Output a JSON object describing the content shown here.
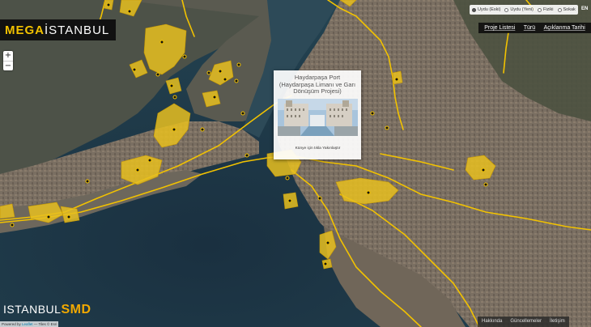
{
  "app": {
    "logo_mega": "MEGA",
    "logo_istanbul": "İSTANBUL"
  },
  "zoom": {
    "in_label": "+",
    "out_label": "−"
  },
  "layers": {
    "options": [
      {
        "label": "Uydu (Eski)",
        "selected": true
      },
      {
        "label": "Uydu (Yeni)",
        "selected": false
      },
      {
        "label": "Fiziki",
        "selected": false
      },
      {
        "label": "Sokak",
        "selected": false
      }
    ],
    "language": "EN"
  },
  "menu": {
    "project_list": "Proje Listesi",
    "type": "Türü",
    "announcement_date": "Açıklanma Tarihi"
  },
  "popup": {
    "title": "Haydarpaşa Port (Haydarpaşa Limanı ve Garı Dönüşüm Projesi)",
    "caption": "Künye için tıkla Yakınlaştır"
  },
  "brand": {
    "istanbul": "ISTANBUL",
    "smd": "SMD"
  },
  "attribution": {
    "powered_by": "Powered by ",
    "leaflet": "Leaflet",
    "tiles": " — Tiles © Esri"
  },
  "footer": {
    "about": "Hakkında",
    "updates": "Güncellemeler",
    "contact": "İletişim"
  },
  "colors": {
    "accent": "#f2c200",
    "project_fill": "#e8c020",
    "sea": "#1f3a4a",
    "land": "#6e6a5e"
  },
  "icons": {
    "marker": "dot-marker-icon"
  }
}
